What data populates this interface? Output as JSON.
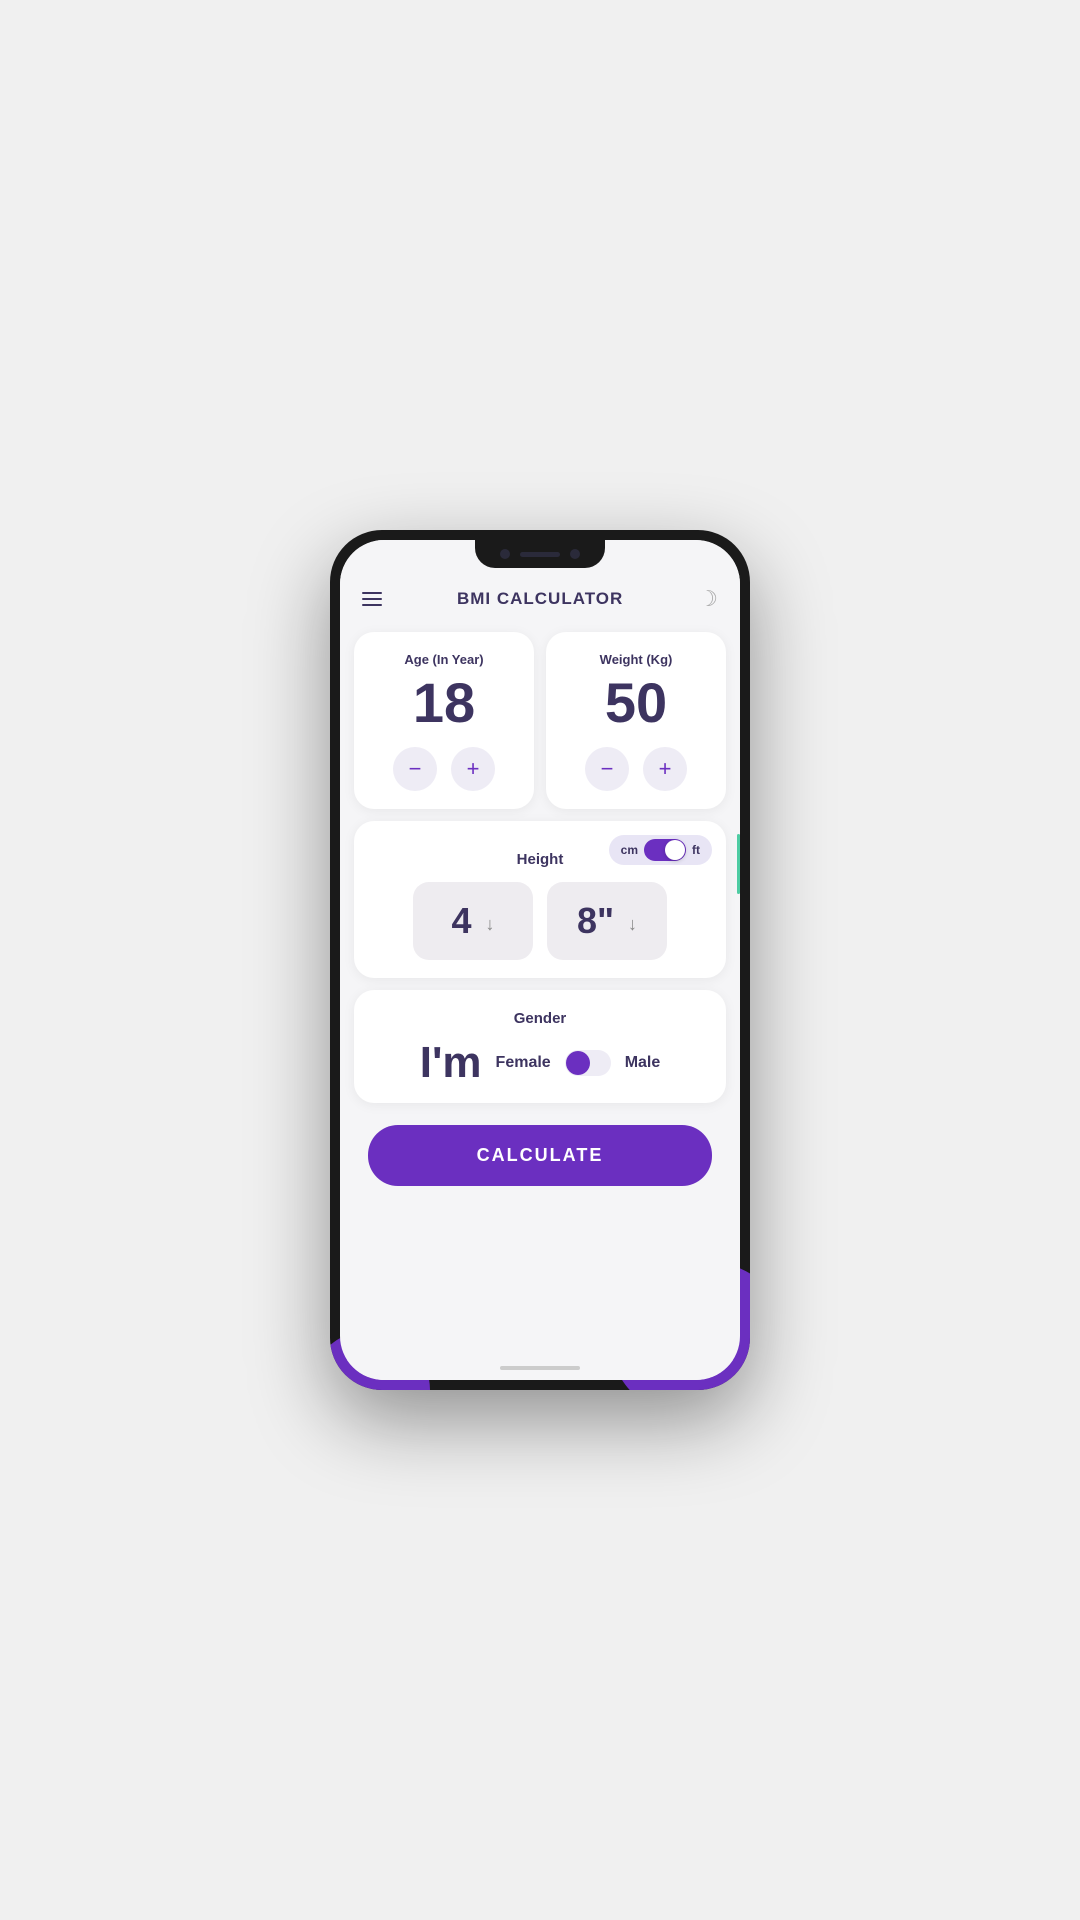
{
  "header": {
    "title": "BMI CALCULATOR",
    "menu_icon": "hamburger",
    "theme_icon": "moon"
  },
  "age_card": {
    "label": "Age (In Year)",
    "value": "18",
    "decrement_label": "−",
    "increment_label": "+"
  },
  "weight_card": {
    "label": "Weight (Kg)",
    "value": "50",
    "decrement_label": "−",
    "increment_label": "+"
  },
  "height_card": {
    "label": "Height",
    "unit_cm": "cm",
    "unit_ft": "ft",
    "feet_value": "4",
    "inches_value": "8\"",
    "toggle_active": "ft"
  },
  "gender_card": {
    "label": "Gender",
    "prefix": "I'm",
    "female_label": "Female",
    "male_label": "Male",
    "selected": "Female"
  },
  "calculate_button": {
    "label": "CALCULATE"
  },
  "colors": {
    "primary": "#6b2fc0",
    "text_dark": "#3d3460",
    "bg_card": "#ffffff",
    "bg_screen": "#f5f5f7",
    "accent_teal": "#4ecca3"
  }
}
